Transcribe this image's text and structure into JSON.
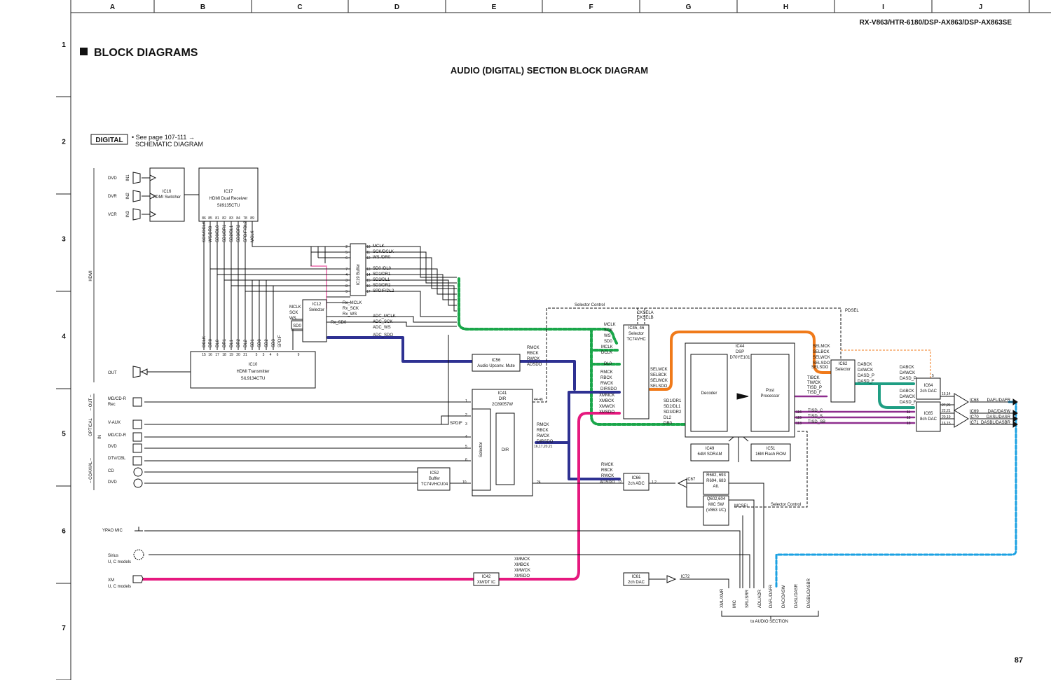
{
  "header": {
    "model": "RX-V863/HTR-6180/DSP-AX863/DSP-AX863SE",
    "section_title": "BLOCK DIAGRAMS",
    "diagram_title": "AUDIO (DIGITAL) SECTION BLOCK DIAGRAM",
    "page_number": "87"
  },
  "grid": {
    "columns": [
      "A",
      "B",
      "C",
      "D",
      "E",
      "F",
      "G",
      "H",
      "I",
      "J"
    ],
    "rows": [
      "1",
      "2",
      "3",
      "4",
      "5",
      "6",
      "7"
    ]
  },
  "digital_badge": "DIGITAL",
  "note": {
    "line1": "• See page 107-111 →",
    "line2": "SCHEMATIC DIAGRAM"
  },
  "groups": {
    "hdmi": "HDMI",
    "optical": "OPTICAL",
    "out": "– OUT –",
    "in": "IN",
    "coaxial": "– COAXIAL –"
  },
  "inputs": {
    "hdmi": [
      {
        "label": "DVD",
        "port": "IN1"
      },
      {
        "label": "DVR",
        "port": "IN2"
      },
      {
        "label": "VCR",
        "port": "IN3"
      }
    ],
    "hdmi_out": "OUT",
    "optical": [
      "MD/CD-R",
      "Rec",
      "V-AUX",
      "MD/CD-R",
      "DVD",
      "DTV/CBL"
    ],
    "coaxial": [
      "CD",
      "DVD"
    ],
    "misc": [
      "YPAO MIC",
      "Sirius",
      "U, C models",
      "XM",
      "U, C models"
    ]
  },
  "ics": {
    "ic16": [
      "IC16",
      "HDMI Switcher"
    ],
    "ic17": [
      "IC17",
      "HDMI Dual Receiver",
      "SiI9135CTU"
    ],
    "ic10": [
      "IC10",
      "HDMI Transmitter",
      "SIL9134CTU"
    ],
    "ic19": [
      "IC19",
      "Buffer"
    ],
    "ic12": [
      "IC12",
      "Selector"
    ],
    "ic56": [
      "IC56",
      "Audio Upconv. Mute"
    ],
    "ic41": [
      "IC41",
      "DIR",
      "2C89057W"
    ],
    "ic41_sel": "Selector",
    "ic41_dir": "DIR",
    "ic52": [
      "IC52",
      "Buffer",
      "TC74VHCU04"
    ],
    "ic45": [
      "IC45, 46",
      "Selector",
      "TC74VHC"
    ],
    "ic44": [
      "IC44",
      "DSP",
      "D70YE101"
    ],
    "decoder": "Decoder",
    "post": [
      "Post",
      "Processor"
    ],
    "ic49": [
      "IC49",
      "64M SDRAM"
    ],
    "ic51": [
      "IC51",
      "16M Flash ROM"
    ],
    "ic62": [
      "IC62",
      "Selector"
    ],
    "ic64": [
      "IC64",
      "2ch DAC"
    ],
    "ic65": [
      "IC65",
      "8ch DAC"
    ],
    "ic66": [
      "IC66",
      "2ch ADC"
    ],
    "ic67": "IC67",
    "ic42": [
      "IC42",
      "XM/DT IC"
    ],
    "ic61": [
      "IC61",
      "2ch DAC"
    ],
    "ic72": "IC72",
    "att": [
      "R682, 693",
      "R694, 683",
      "Att."
    ],
    "q602": [
      "Q602,604",
      "MIC SW",
      "(V863 UC)"
    ]
  },
  "signals": {
    "ic17_pins": [
      "SCK/DCLK",
      "WS/DR0",
      "SD0/DL0",
      "SD1/DR1",
      "SD2/DL1",
      "SD3/DR2",
      "SPDIF/DL2",
      "MCLK"
    ],
    "ic17_pin_nums": [
      "86",
      "85",
      "81",
      "82",
      "83",
      "84",
      "78",
      "89"
    ],
    "ic19_in_nums": [
      "2",
      "5",
      "6",
      "7",
      "4",
      "3",
      "8",
      "9"
    ],
    "ic19_out": [
      "MCLK",
      "SCK/DCLK",
      "WS /DR0",
      "SD0 /DL0",
      "SD1/DR1",
      "SD2/DL1",
      "SD3/DR2",
      "SPDIF/DL2"
    ],
    "ic19_out_nums": [
      "18",
      "11",
      "12",
      "13",
      "14",
      "15",
      "16",
      "17"
    ],
    "ic12_in": [
      "MCLK",
      "SCK",
      "WS"
    ],
    "ic12_sd0": "SD0",
    "ic12_out": [
      "Rx_MCLK",
      "Rx_SCK",
      "Rx_WS"
    ],
    "rx_sd0": "Rx_SD0",
    "adc_sigs": [
      "ADC_MCLK",
      "ADC_SCK",
      "ADC_WS",
      "ADC_SDO"
    ],
    "ic10_pins": [
      "DCLK",
      "DR0",
      "DL0",
      "DR1",
      "DL1",
      "DR2",
      "DL2",
      "SD1",
      "SD0",
      "SD2",
      "SD3",
      "SPDIF"
    ],
    "ic10_pin_nums": [
      "15",
      "16",
      "17",
      "18",
      "19",
      "20",
      "21",
      "5",
      "3",
      "4",
      "6",
      "9"
    ],
    "ic45_in_top": [
      "MCLK",
      "SCK",
      "WS",
      "SD0"
    ],
    "ic45_in_mid": [
      "MCLK",
      "DCLK",
      "DL0"
    ],
    "ic45_in_rbck": [
      "RMCK",
      "RBCK",
      "RWCK",
      "DIRSDO"
    ],
    "ic45_in_xm": [
      "XMMCK",
      "XMBCK",
      "XMWCK",
      "XMSDO"
    ],
    "ic45_out": [
      "SELMCK",
      "SELBCK",
      "SELWCK",
      "SELSDO"
    ],
    "cksel": [
      "CKSELA",
      "CKSELB"
    ],
    "selector_control": "Selector Control",
    "selector_control2": "Selector Control",
    "pdsel": "PDSEL",
    "ic56_in": [
      "RMCK",
      "RBCK",
      "RWCK",
      "ADSDO"
    ],
    "ic41_out": [
      "RMCK",
      "RBCK",
      "RWCK",
      "DIRSDO"
    ],
    "ic41_pin_nums": [
      "1",
      "2",
      "3",
      "4",
      "5",
      "6",
      "7",
      "8",
      "10",
      "24",
      "44-46",
      "16,17,20,21"
    ],
    "spdif": "SPDIF",
    "ic66_in": [
      "RMCK",
      "RBCK",
      "RWCK",
      "ADSDO"
    ],
    "ic66_pin": "1,2",
    "ic66_pin2": "12",
    "dsp_in": [
      "SD1/DR1",
      "SD2/DL1",
      "SD3/DR2",
      "DL2",
      "DR0"
    ],
    "dsp_out_top": [
      "TIBCK",
      "TIWCK",
      "TISD_P",
      "TISD_F"
    ],
    "dsp_out_bot": [
      "TISD_C",
      "TISD_S",
      "TISD_SB"
    ],
    "dsp_out_nums": [
      "116",
      "115",
      "113"
    ],
    "ic62_in": [
      "SELMCK",
      "SELBCK",
      "SELWCK",
      "SELSDO",
      "SELSDO"
    ],
    "ic62_out": [
      "DABCK",
      "DAWCK",
      "DASD_P",
      "DASD_F"
    ],
    "ic64_in": [
      "DABCK",
      "DAWCK",
      "DASD_P"
    ],
    "ic64_pin": "5",
    "ic65_in": [
      "DABCK",
      "DAWCK",
      "DASD_F"
    ],
    "ic65_pin_nums": [
      "11",
      "12",
      "13"
    ],
    "dac_pins": [
      "15,14",
      "27,26",
      "22,21",
      "20,19",
      "16,15"
    ],
    "dac_ics": [
      "IC68",
      "IC69",
      "IC70",
      "IC71"
    ],
    "dac_out": [
      "DAFL/DAFR",
      "DAC/DASW",
      "DASL/DASR",
      "DASBL/DASBR"
    ],
    "xm_sigs": [
      "XMMCK",
      "XMBCK",
      "XMWCK",
      "XMSDO"
    ],
    "mcsel": "MCSEL",
    "bottom_labels": [
      "XML/XMR",
      "MIC",
      "SRL/SRR",
      "ADL/ADR",
      "DAFL/DAFR",
      "DAC/DASW",
      "DASL/DASR",
      "DASBL/DASBR"
    ],
    "to_audio": "to AUDIO SECTION"
  },
  "colors": {
    "green": "#1aa64a",
    "blue": "#2e3192",
    "orange": "#f07a1a",
    "magenta": "#e6197f",
    "purple": "#8e2d8e",
    "teal": "#1f9e83",
    "cyan": "#1ba1e2",
    "pink": "#f08fc0"
  }
}
